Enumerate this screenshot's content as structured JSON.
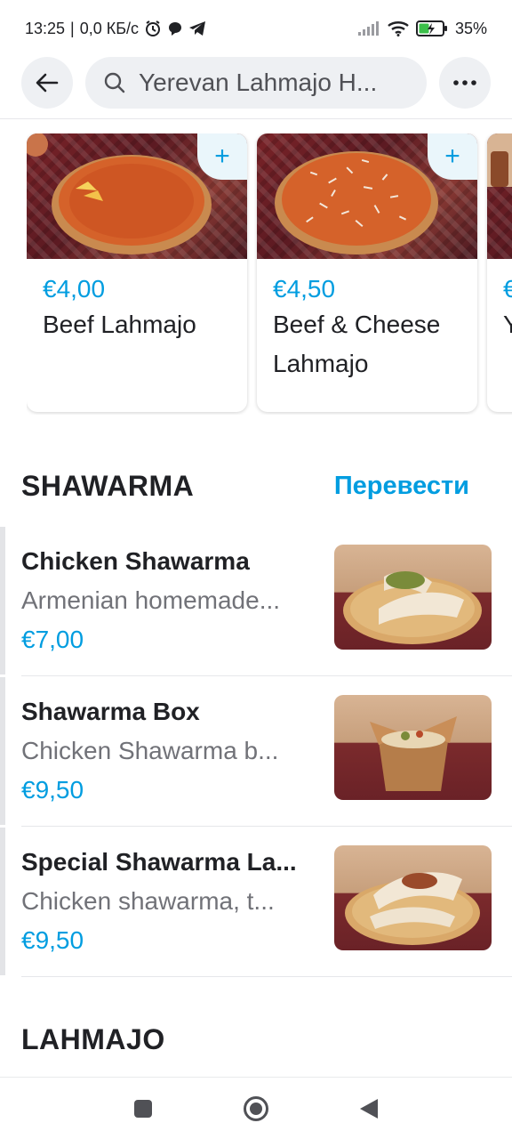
{
  "status_bar": {
    "time": "13:25",
    "network_speed": "0,0 КБ/с",
    "battery": "35%"
  },
  "header": {
    "search_text": "Yerevan Lahmajo H...",
    "back_icon": "arrow-left-icon",
    "search_icon": "search-icon",
    "more_icon": "more-horizontal-icon"
  },
  "carousel": {
    "items": [
      {
        "price": "€4,00",
        "name": "Beef Lahmajo"
      },
      {
        "price": "€4,50",
        "name": "Beef & Cheese Lahmajo"
      },
      {
        "price": "€",
        "name": "Y H"
      }
    ]
  },
  "sections": {
    "shawarma": {
      "title": "SHAWARMA",
      "translate": "Перевести"
    },
    "lahmajo": {
      "title": "LAHMAJO"
    }
  },
  "shawarma_items": [
    {
      "name": "Chicken Shawarma",
      "description": "Armenian homemade...",
      "price": "€7,00"
    },
    {
      "name": "Shawarma Box",
      "description": "Chicken Shawarma b...",
      "price": "€9,50"
    },
    {
      "name": "Special Shawarma La...",
      "description": "Chicken shawarma, t...",
      "price": "€9,50"
    }
  ],
  "colors": {
    "accent": "#009de0",
    "text": "#202125",
    "muted": "#717278",
    "pill": "#eef0f3"
  }
}
